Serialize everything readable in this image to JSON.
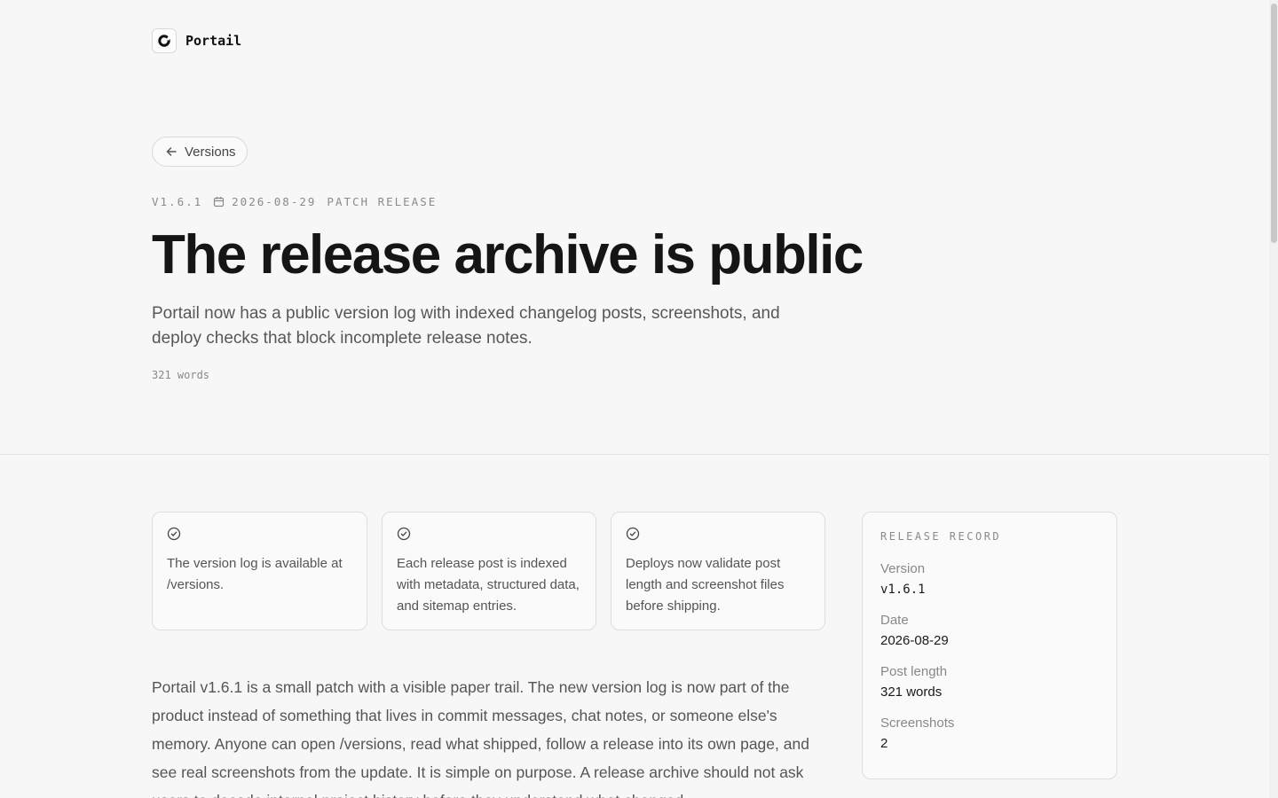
{
  "header": {
    "brand": "Portail",
    "logo_icon": "portail-logo-icon"
  },
  "nav": {
    "back_label": "Versions",
    "back_icon": "arrow-left-icon"
  },
  "release": {
    "version_tag": "V1.6.1",
    "date": "2026-08-29",
    "type": "PATCH RELEASE",
    "title": "The release archive is public",
    "subtitle": "Portail now has a public version log with indexed changelog posts, screenshots, and deploy checks that block incomplete release notes.",
    "word_count": "321 words"
  },
  "highlights": [
    {
      "icon": "check-circle-icon",
      "text": "The version log is available at /versions."
    },
    {
      "icon": "check-circle-icon",
      "text": "Each release post is indexed with metadata, structured data, and sitemap entries."
    },
    {
      "icon": "check-circle-icon",
      "text": "Deploys now validate post length and screenshot files before shipping."
    }
  ],
  "body": {
    "paragraph": "Portail v1.6.1 is a small patch with a visible paper trail. The new version log is now part of the product instead of something that lives in commit messages, chat notes, or someone else's memory. Anyone can open /versions, read what shipped, follow a release into its own page, and see real screenshots from the update. It is simple on purpose. A release archive should not ask users to decode internal project history before they understand what changed."
  },
  "record": {
    "title": "RELEASE RECORD",
    "items": [
      {
        "label": "Version",
        "value": "v1.6.1"
      },
      {
        "label": "Date",
        "value": "2026-08-29"
      },
      {
        "label": "Post length",
        "value": "321 words"
      },
      {
        "label": "Screenshots",
        "value": "2"
      }
    ]
  }
}
